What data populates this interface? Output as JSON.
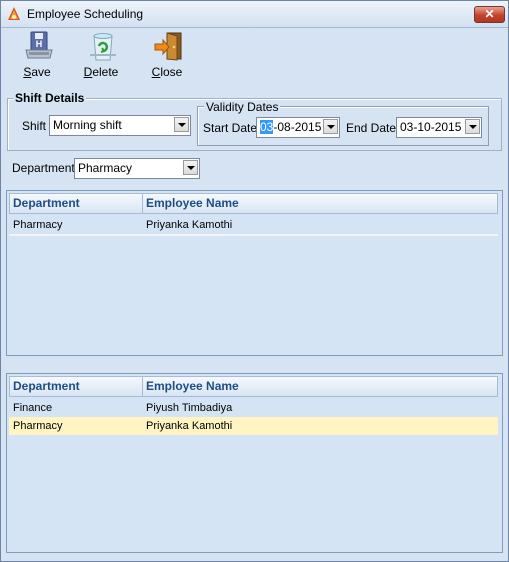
{
  "window": {
    "title": "Employee Scheduling",
    "close_glyph": "✕"
  },
  "toolbar": {
    "save": {
      "label": "Save",
      "icon": "floppy-disk-icon"
    },
    "delete": {
      "label": "Delete",
      "icon": "recycle-bin-icon"
    },
    "close": {
      "label": "Close",
      "icon": "exit-door-icon"
    }
  },
  "shift_details": {
    "legend": "Shift Details",
    "shift_label": "Shift",
    "shift_value": "Morning shift",
    "validity": {
      "legend": "Validity Dates",
      "start_label": "Start Date",
      "start_day": "03",
      "start_rest": "-08-2015",
      "end_label": "End Date",
      "end_value": "03-10-2015"
    }
  },
  "department": {
    "label": "Department",
    "value": "Pharmacy"
  },
  "top_grid": {
    "columns": [
      "Department",
      "Employee Name"
    ],
    "rows": [
      {
        "department": "Pharmacy",
        "employee": "Priyanka Kamothi"
      }
    ]
  },
  "bottom_grid": {
    "columns": [
      "Department",
      "Employee Name"
    ],
    "rows": [
      {
        "department": "Finance",
        "employee": "Piyush Timbadiya"
      },
      {
        "department": "Pharmacy",
        "employee": "Priyanka Kamothi",
        "selected": true
      }
    ]
  },
  "colors": {
    "window_bg": "#d5e3f3",
    "header_text": "#1e4d85",
    "selected_row": "#fff4c2",
    "close_button": "#c4432b"
  }
}
